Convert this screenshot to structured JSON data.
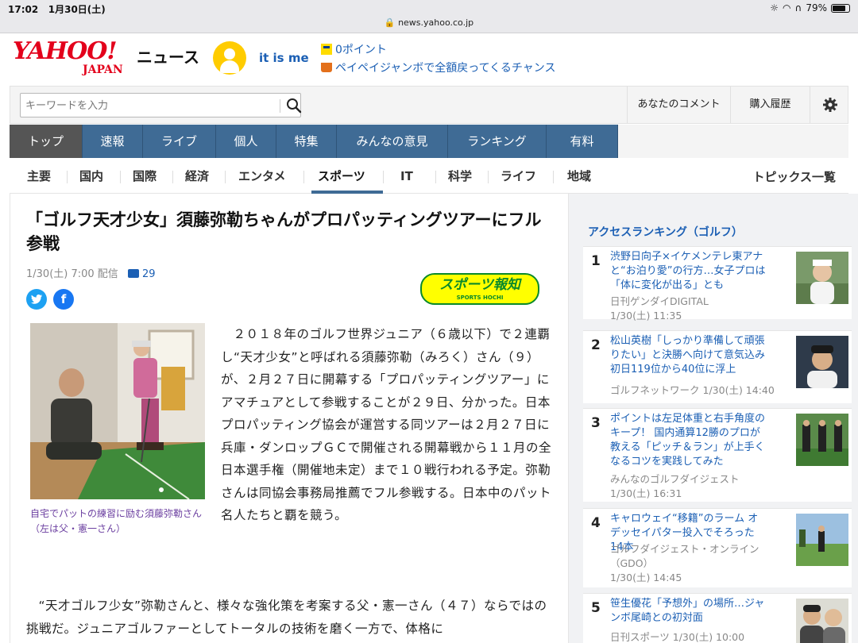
{
  "status": {
    "time": "17:02",
    "date": "1月30日(土)",
    "battery": "79%",
    "url": "news.yahoo.co.jp"
  },
  "header": {
    "logo_main": "YAHOO!",
    "logo_sub": "JAPAN",
    "section": "ニュース",
    "username": "it is me",
    "points": "0ポイント",
    "promo": "ペイペイジャンボで全額戻ってくるチャンス"
  },
  "search": {
    "placeholder": "キーワードを入力"
  },
  "header_links": {
    "comments": "あなたのコメント",
    "history": "購入履歴"
  },
  "global_nav": [
    "トップ",
    "速報",
    "ライブ",
    "個人",
    "特集",
    "みんなの意見",
    "ランキング",
    "有料"
  ],
  "sub_nav": [
    "主要",
    "国内",
    "国際",
    "経済",
    "エンタメ",
    "スポーツ",
    "IT",
    "科学",
    "ライフ",
    "地域"
  ],
  "topics_link": "トピックス一覧",
  "article": {
    "title": "「ゴルフ天才少女」須藤弥勒ちゃんがプロパッティングツアーにフル参戦",
    "date": "1/30(土) 7:00 配信",
    "comments": "29",
    "source_logo": "スポーツ報知",
    "source_logo_sub": "SPORTS HOCHI",
    "photo_caption": "自宅でパットの練習に励む須藤弥勒さん（左は父・憲一さん）",
    "paragraph1": "２０１８年のゴルフ世界ジュニア（６歳以下）で２連覇し“天才少女”と呼ばれる須藤弥勒（みろく）さん（９）が、２月２７日に開幕する「プロパッティングツアー」にアマチュアとして参戦することが２９日、分かった。日本プロパッティング協会が運営する同ツアーは２月２７日に兵庫・ダンロップＧＣで開催される開幕戦から１１月の全日本選手権（開催地未定）まで１０戦行われる予定。弥勒さんは同協会事務局推薦でフル参戦する。日本中のパット名人たちと覇を競う。",
    "paragraph2": "“天才ゴルフ少女”弥勒さんと、様々な強化策を考案する父・憲一さん（４７）ならではの挑戦だ。ジュニアゴルファーとしてトータルの技術を磨く一方で、体格に"
  },
  "ranking": {
    "title": "アクセスランキング（ゴルフ）",
    "items": [
      {
        "num": "1",
        "title": "渋野日向子×イケメンテレ東アナと“お泊り愛”の行方…女子プロは「体に変化が出る」とも",
        "source": "日刊ゲンダイDIGITAL",
        "date": "1/30(土) 11:35"
      },
      {
        "num": "2",
        "title": "松山英樹「しっかり準備して頑張りたい」と決勝へ向けて意気込み　初日119位から40位に浮上",
        "source": "ゴルフネットワーク",
        "date": "1/30(土) 14:40"
      },
      {
        "num": "3",
        "title": "ポイントは左足体重と右手角度のキープ！ 国内通算12勝のプロが教える「ピッチ＆ラン」が上手くなるコツを実践してみた",
        "source": "みんなのゴルフダイジェスト",
        "date": "1/30(土) 16:31"
      },
      {
        "num": "4",
        "title": "キャロウェイ“移籍”のラーム オデッセイパター投入でそろった14本",
        "source": "ゴルフダイジェスト・オンライン（GDO）",
        "date": "1/30(土) 14:45"
      },
      {
        "num": "5",
        "title": "笹生優花「予想外」の場所…ジャンボ尾崎との初対面",
        "source": "日刊スポーツ",
        "date": "1/30(土) 10:00"
      }
    ]
  },
  "colors": {
    "brand_red": "#e3001b",
    "nav_blue": "#3f6b95",
    "link_blue": "#1b5fb4",
    "caption_purple": "#6b3fa0"
  }
}
